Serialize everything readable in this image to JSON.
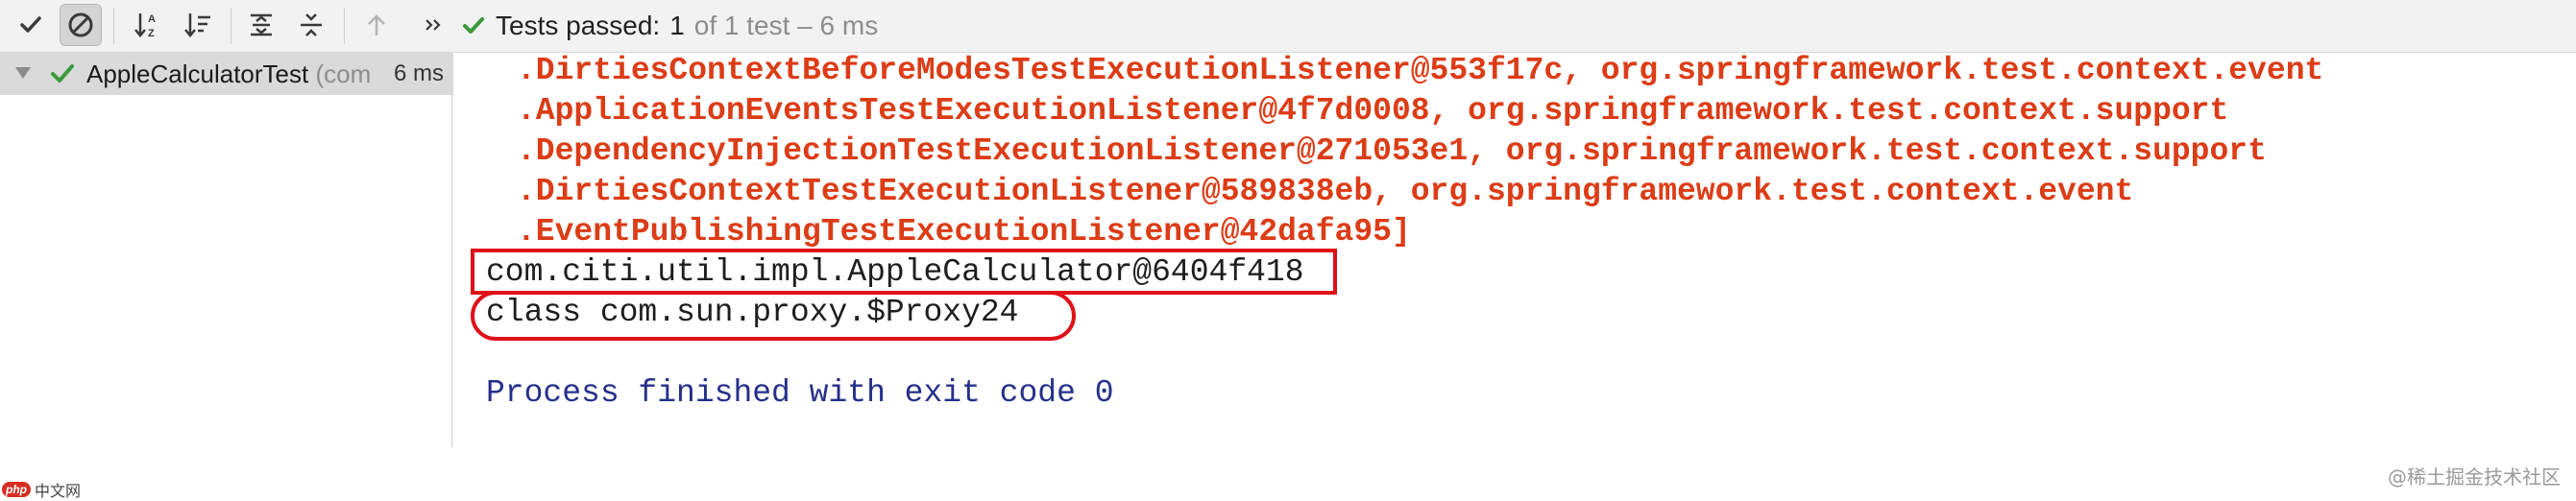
{
  "toolbar": {
    "buttons": [
      {
        "name": "show-passed-icon",
        "toggled": false
      },
      {
        "name": "show-ignored-icon",
        "toggled": true
      },
      {
        "name": "sort-alphabetically-icon",
        "toggled": false
      },
      {
        "name": "sort-by-duration-icon",
        "toggled": false
      },
      {
        "name": "expand-all-icon",
        "toggled": false
      },
      {
        "name": "collapse-all-icon",
        "toggled": false
      },
      {
        "name": "previous-failed-icon",
        "toggled": false
      },
      {
        "name": "more-icon",
        "toggled": false
      }
    ],
    "status_label": "Tests passed:",
    "status_count": "1",
    "status_detail": "of 1 test – 6 ms"
  },
  "tree": {
    "items": [
      {
        "label": "AppleCalculatorTest",
        "hint": "(com",
        "time": "6 ms",
        "status": "passed"
      }
    ]
  },
  "console": {
    "lines": [
      ".DirtiesContextBeforeModesTestExecutionListener@553f17c, org.springframework.test.context.event",
      ".ApplicationEventsTestExecutionListener@4f7d0008, org.springframework.test.context.support",
      ".DependencyInjectionTestExecutionListener@271053e1, org.springframework.test.context.support",
      ".DirtiesContextTestExecutionListener@589838eb, org.springframework.test.context.event",
      ".EventPublishingTestExecutionListener@42dafa95]",
      "com.citi.util.impl.AppleCalculator@6404f418",
      "class com.sun.proxy.$Proxy24",
      "",
      "Process finished with exit code 0"
    ]
  },
  "watermarks": {
    "left_badge": "php",
    "left_text": "中文网",
    "right_text": "@稀土掘金技术社区"
  },
  "colors": {
    "error_text": "#dc3c16",
    "process_text": "#26308a",
    "annotation_red": "#e01018",
    "pass_green": "#3a9a3a"
  }
}
